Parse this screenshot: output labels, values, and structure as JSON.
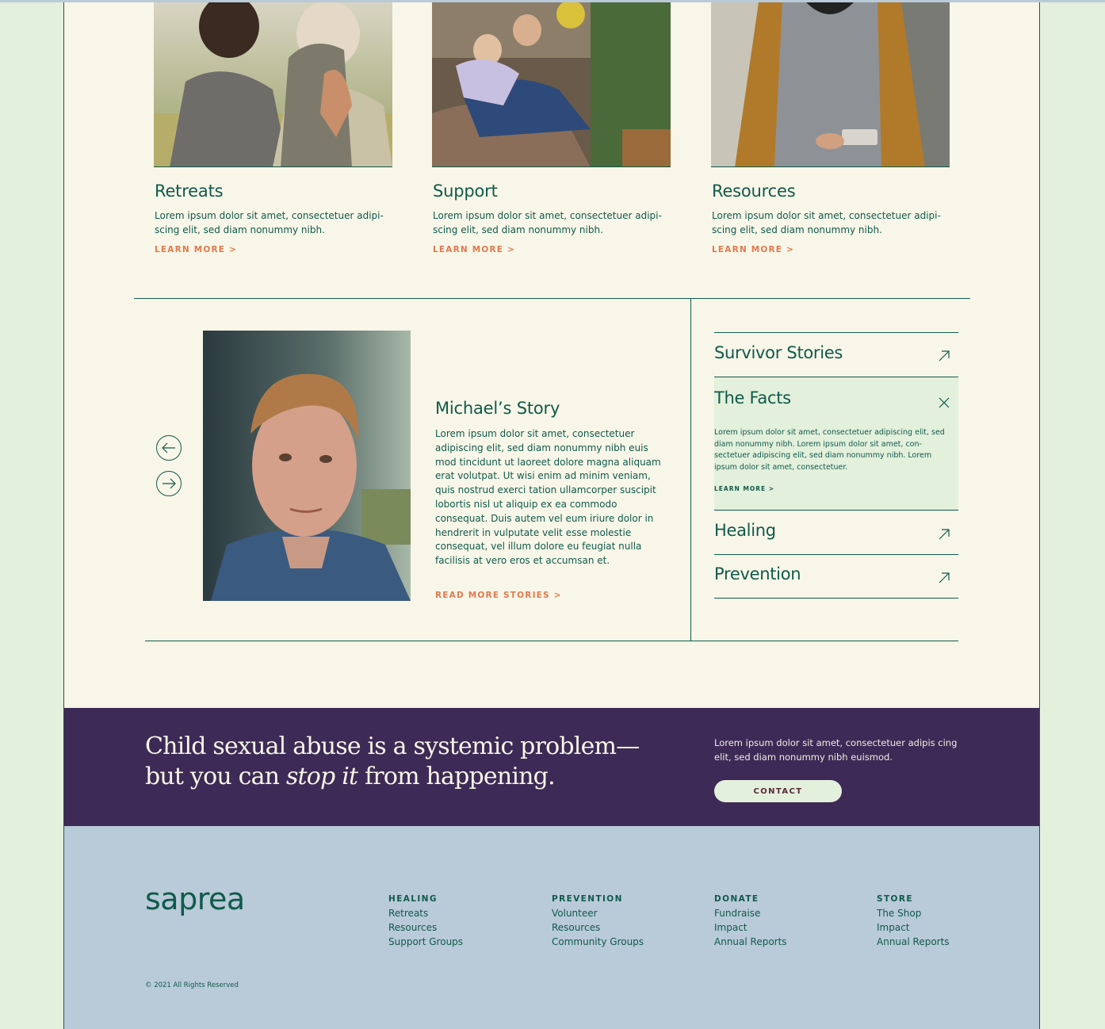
{
  "colors": {
    "accent": "#e07a4f",
    "text": "#0f5a4b",
    "page_bg": "#f8f6e8",
    "cta_bg": "#3e2a56",
    "footer_bg": "#b9cad8",
    "highlight": "#e3f0dc"
  },
  "cards": [
    {
      "title": "Retreats",
      "text": "Lorem ipsum dolor sit amet, consectetuer adipi- scing elit, sed diam nonummy nibh.",
      "link": "LEARN MORE >"
    },
    {
      "title": "Support",
      "text": "Lorem ipsum dolor sit amet, consectetuer adipi- scing elit, sed diam nonummy nibh.",
      "link": "LEARN MORE >"
    },
    {
      "title": "Resources",
      "text": "Lorem ipsum dolor sit amet, consectetuer adipi- scing elit, sed diam nonummy nibh.",
      "link": "LEARN MORE >"
    }
  ],
  "story": {
    "title": "Michael’s Story",
    "body": "Lorem ipsum dolor sit amet, consectetuer adipiscing elit, sed diam nonummy nibh euis mod tincidunt ut laoreet dolore magna aliquam erat volutpat. Ut wisi enim ad minim veniam, quis nostrud exerci tation ullamcorper suscipit lobortis nisl ut aliquip ex ea commodo consequat. Duis autem vel eum iriure dolor in hendrerit in vulputate velit esse molestie consequat, vel illum dolore eu feugiat nulla facilisis at vero eros et accumsan et.",
    "link": "READ MORE STORIES >",
    "prev_icon": "arrow-left-icon",
    "next_icon": "arrow-right-icon"
  },
  "accordion": {
    "items": [
      {
        "title": "Survivor Stories",
        "icon": "arrow-up-right-icon"
      },
      {
        "title": "The Facts",
        "icon": "close-icon",
        "expanded": true,
        "body": "Lorem ipsum dolor sit amet, consectetuer adipiscing elit, sed diam nonummy nibh. Lorem ipsum dolor sit amet, con- sectetuer adipiscing elit, sed diam nonummy nibh. Lorem ipsum dolor sit amet, consectetuer.",
        "link": "LEARN MORE >"
      },
      {
        "title": "Healing",
        "icon": "arrow-up-right-icon"
      },
      {
        "title": "Prevention",
        "icon": "arrow-up-right-icon"
      }
    ]
  },
  "cta": {
    "line1": "Child sexual abuse is a systemic problem—",
    "line2_before": "but you can ",
    "line2_em": "stop it",
    "line2_after": " from happening.",
    "text": "Lorem ipsum dolor sit amet, consectetuer adipis cing elit, sed diam nonummy nibh euismod.",
    "button": "CONTACT"
  },
  "footer": {
    "logo": "saprea",
    "columns": [
      {
        "heading": "HEALING",
        "links": [
          "Retreats",
          "Resources",
          "Support Groups"
        ]
      },
      {
        "heading": "PREVENTION",
        "links": [
          "Volunteer",
          "Resources",
          "Community Groups"
        ]
      },
      {
        "heading": "DONATE",
        "links": [
          "Fundraise",
          "Impact",
          "Annual Reports"
        ]
      },
      {
        "heading": "STORE",
        "links": [
          "The Shop",
          "Impact",
          "Annual Reports"
        ]
      }
    ],
    "copyright": "© 2021 All Rights Reserved"
  }
}
